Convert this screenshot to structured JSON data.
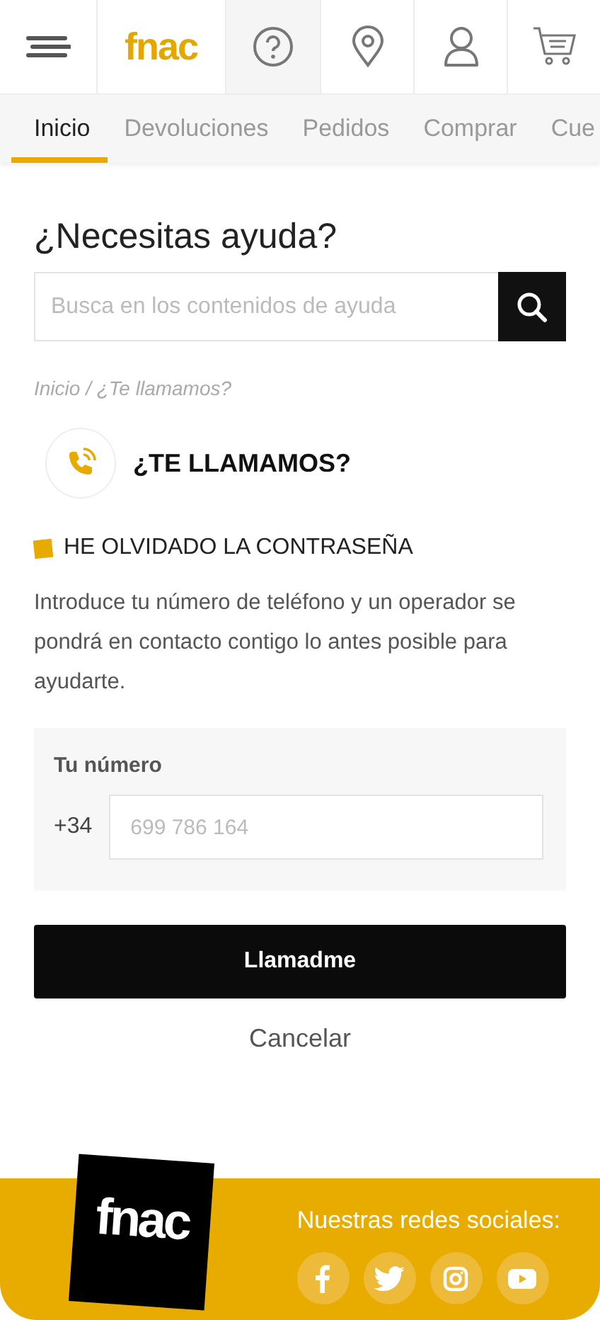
{
  "header": {
    "logo": "fnac"
  },
  "tabs": [
    {
      "label": "Inicio",
      "selected": true
    },
    {
      "label": "Devoluciones",
      "selected": false
    },
    {
      "label": "Pedidos",
      "selected": false
    },
    {
      "label": "Comprar",
      "selected": false
    },
    {
      "label": "Cue",
      "selected": false
    }
  ],
  "title": "¿Necesitas ayuda?",
  "search": {
    "placeholder": "Busca en los contenidos de ayuda"
  },
  "breadcrumb": "Inicio / ¿Te llamamos?",
  "section_title": "¿TE LLAMAMOS?",
  "topic": "HE OLVIDADO LA CONTRASEÑA",
  "description": "Introduce tu número de teléfono y un operador se pondrá en contacto contigo lo antes posible para ayudarte.",
  "form": {
    "label": "Tu número",
    "prefix": "+34",
    "placeholder": "699 786 164"
  },
  "submit": "Llamadme",
  "cancel": "Cancelar",
  "footer": {
    "logo": "fnac",
    "social_label": "Nuestras redes sociales:"
  }
}
